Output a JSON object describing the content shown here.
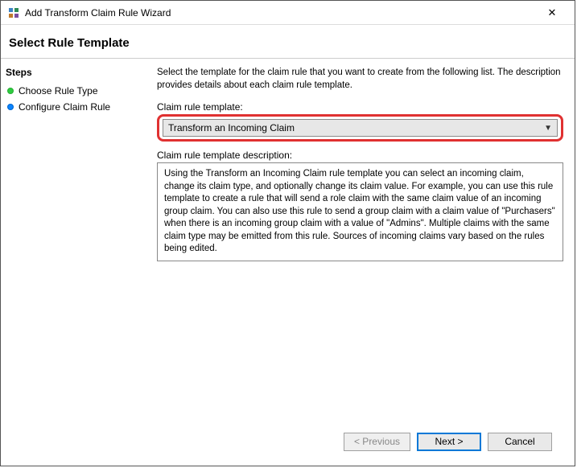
{
  "window": {
    "title": "Add Transform Claim Rule Wizard",
    "close_glyph": "✕"
  },
  "header": "Select Rule Template",
  "sidebar": {
    "title": "Steps",
    "items": [
      {
        "label": "Choose Rule Type",
        "state": "green"
      },
      {
        "label": "Configure Claim Rule",
        "state": "blue"
      }
    ]
  },
  "main": {
    "intro": "Select the template for the claim rule that you want to create from the following list. The description provides details about each claim rule template.",
    "template_label": "Claim rule template:",
    "template_selected": "Transform an Incoming Claim",
    "desc_label": "Claim rule template description:",
    "description": "Using the Transform an Incoming Claim rule template you can select an incoming claim, change its claim type, and optionally change its claim value.  For example, you can use this rule template to create a rule that will send a role claim with the same claim value of an incoming group claim.  You can also use this rule to send a group claim with a claim value of \"Purchasers\" when there is an incoming group claim with a value of \"Admins\".  Multiple claims with the same claim type may be emitted from this rule.  Sources of incoming claims vary based on the rules being edited."
  },
  "footer": {
    "previous": "< Previous",
    "next": "Next >",
    "cancel": "Cancel"
  }
}
